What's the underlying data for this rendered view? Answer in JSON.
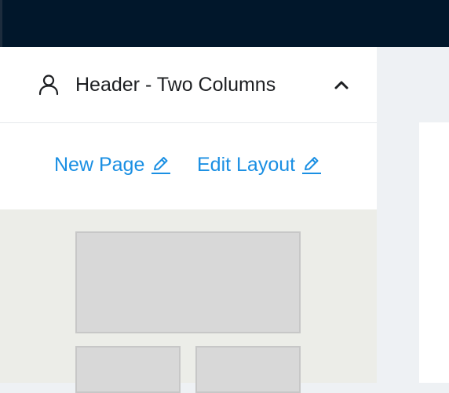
{
  "accordion": {
    "title": "Header - Two Columns",
    "icon": "user-icon",
    "toggle_icon": "chevron-up-icon",
    "expanded": true
  },
  "actions": {
    "new_page_label": "New Page",
    "edit_layout_label": "Edit Layout",
    "link_icon": "pencil-icon"
  },
  "colors": {
    "topbar": "#01172b",
    "link": "#1a8fe3",
    "text": "#1d1f22",
    "preview_bg": "#ecede8",
    "block_fill": "#d8d8d8",
    "page_bg": "#eef1f4"
  },
  "layout_preview": {
    "name": "Header - Two Columns",
    "blocks": [
      "header",
      "column-left",
      "column-right"
    ]
  }
}
